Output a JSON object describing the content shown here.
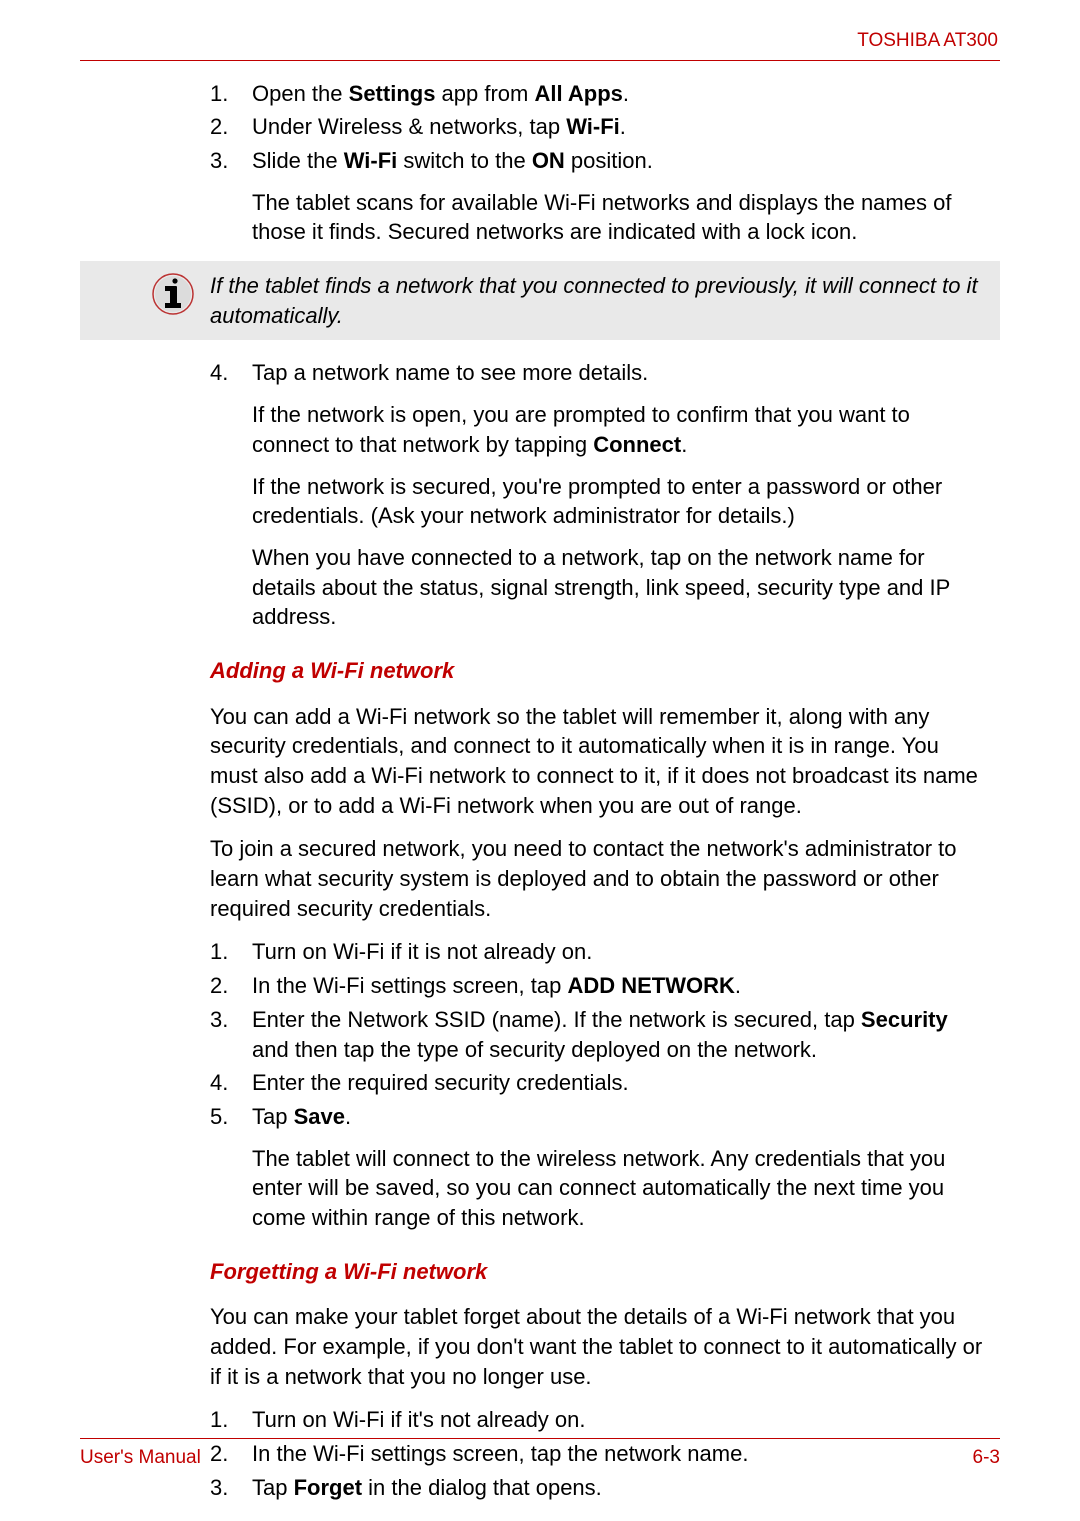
{
  "header": {
    "product": "TOSHIBA AT300"
  },
  "list1": {
    "i1n": "1.",
    "i1": "Open the <b>Settings</b> app from <b>All Apps</b>.",
    "i2n": "2.",
    "i2": "Under Wireless & networks, tap <b>Wi-Fi</b>.",
    "i3n": "3.",
    "i3": "Slide the <b>Wi-Fi</b> switch to the <b>ON</b> position.",
    "i3c": "The tablet scans for available Wi-Fi networks and displays the names of those it finds. Secured networks are indicated with a lock icon."
  },
  "note1": "If the tablet finds a network that you connected to previously, it will connect to it automatically.",
  "list1b": {
    "i4n": "4.",
    "i4": "Tap a network name to see more details.",
    "i4c1": "If the network is open, you are prompted to confirm that you want to connect to that network by tapping <b>Connect</b>.",
    "i4c2": "If the network is secured, you're prompted to enter a password or other credentials. (Ask your network administrator for details.)",
    "i4c3": "When you have connected to a network, tap on the network name for details about the status, signal strength, link speed, security type and IP address."
  },
  "section2": {
    "title": "Adding a Wi-Fi network",
    "p1": "You can add a Wi-Fi network so the tablet will remember it, along with any security credentials, and connect to it automatically when it is in range. You must also add a Wi-Fi network to connect to it, if it does not broadcast its name (SSID), or to add a Wi-Fi network when you are out of range.",
    "p2": "To join a secured network, you need to contact the network's administrator to learn what security system is deployed and to obtain the password or other required security credentials.",
    "i1n": "1.",
    "i1": "Turn on Wi-Fi if it is not already on.",
    "i2n": "2.",
    "i2": "In the Wi-Fi settings screen, tap <b>ADD NETWORK</b>.",
    "i3n": "3.",
    "i3": "Enter the Network SSID (name). If the network is secured, tap <b>Security</b> and then tap the type of security deployed on the network.",
    "i4n": "4.",
    "i4": "Enter the required security credentials.",
    "i5n": "5.",
    "i5": "Tap <b>Save</b>.",
    "i5c": "The tablet will connect to the wireless network. Any credentials that you enter will be saved, so you can connect automatically the next time you come within range of this network."
  },
  "section3": {
    "title": "Forgetting a Wi-Fi network",
    "p1": "You can make your tablet forget about the details of a Wi-Fi network that you added. For example, if you don't want the tablet to connect to it automatically or if it is a network that you no longer use.",
    "i1n": "1.",
    "i1": "Turn on Wi-Fi if it's not already on.",
    "i2n": "2.",
    "i2": "In the Wi-Fi settings screen, tap the network name.",
    "i3n": "3.",
    "i3": "Tap <b>Forget</b> in the dialog that opens."
  },
  "footer": {
    "left": "User's Manual",
    "right": "6-3"
  }
}
